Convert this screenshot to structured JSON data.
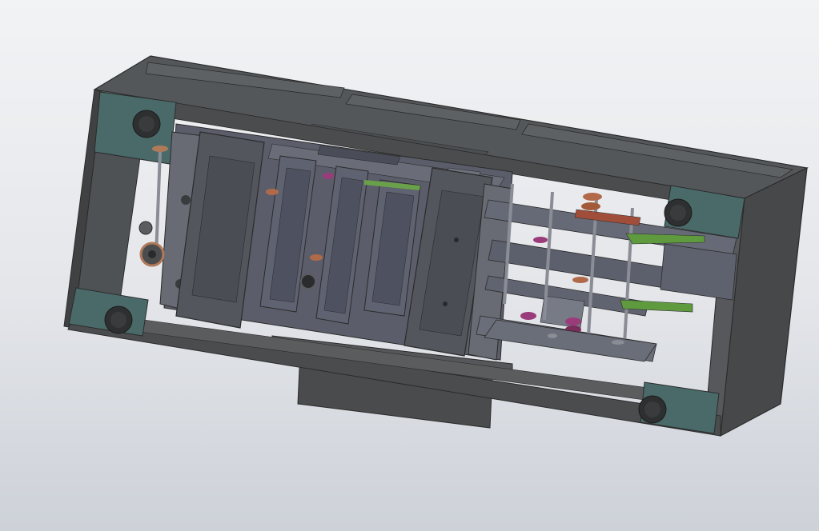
{
  "viewport": {
    "background_top": "#f2f3f5",
    "background_bottom": "#cdd1d8"
  },
  "model": {
    "frame_color": "#4b4c4d",
    "frame_dark": "#3a3b3c",
    "frame_light": "#5d5e5f",
    "plate_color": "#4a6a6a",
    "mechanism_color": "#5b5e6a",
    "accent_green": "#5f9a3f",
    "accent_copper": "#b06a4a",
    "accent_magenta": "#9a3c7a"
  }
}
